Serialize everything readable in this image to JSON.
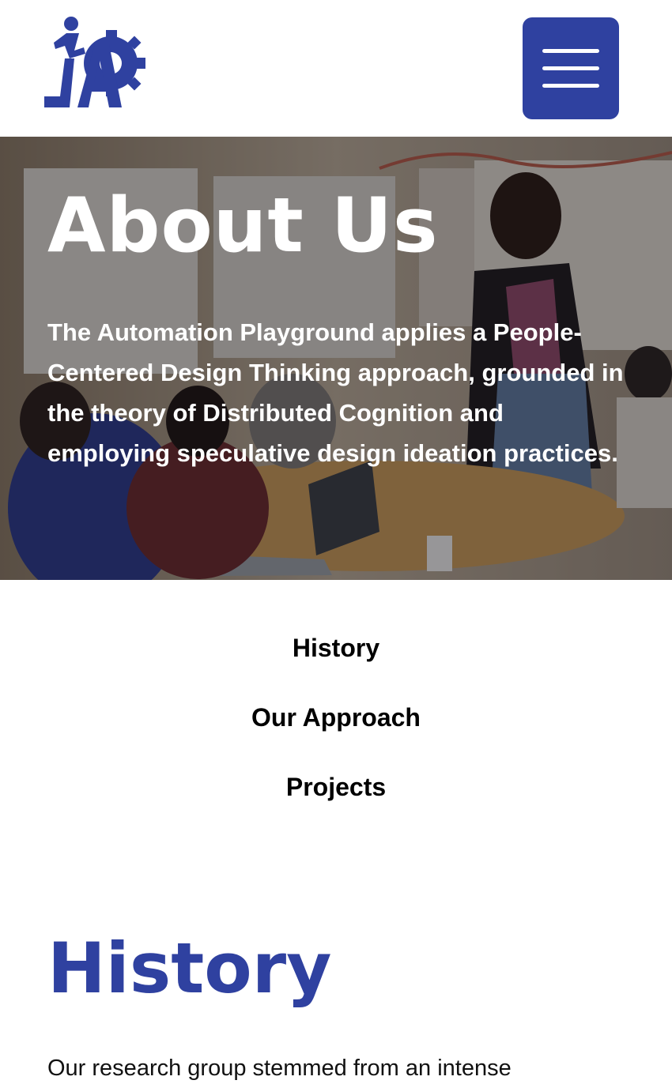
{
  "header": {
    "logo_text": "AP",
    "menu_icon": "hamburger-menu-icon"
  },
  "hero": {
    "title": "About Us",
    "description": "The Automation Playground applies a People-Centered Design Thinking approach, grounded in the theory of Distributed Cognition and employing speculative design ideation practices."
  },
  "subnav": {
    "items": [
      {
        "label": "History"
      },
      {
        "label": "Our Approach"
      },
      {
        "label": "Projects"
      }
    ]
  },
  "history": {
    "title": "History",
    "body": "Our research group stemmed from an intense"
  },
  "colors": {
    "brand": "#2f41a0",
    "text": "#000000",
    "background": "#ffffff"
  }
}
